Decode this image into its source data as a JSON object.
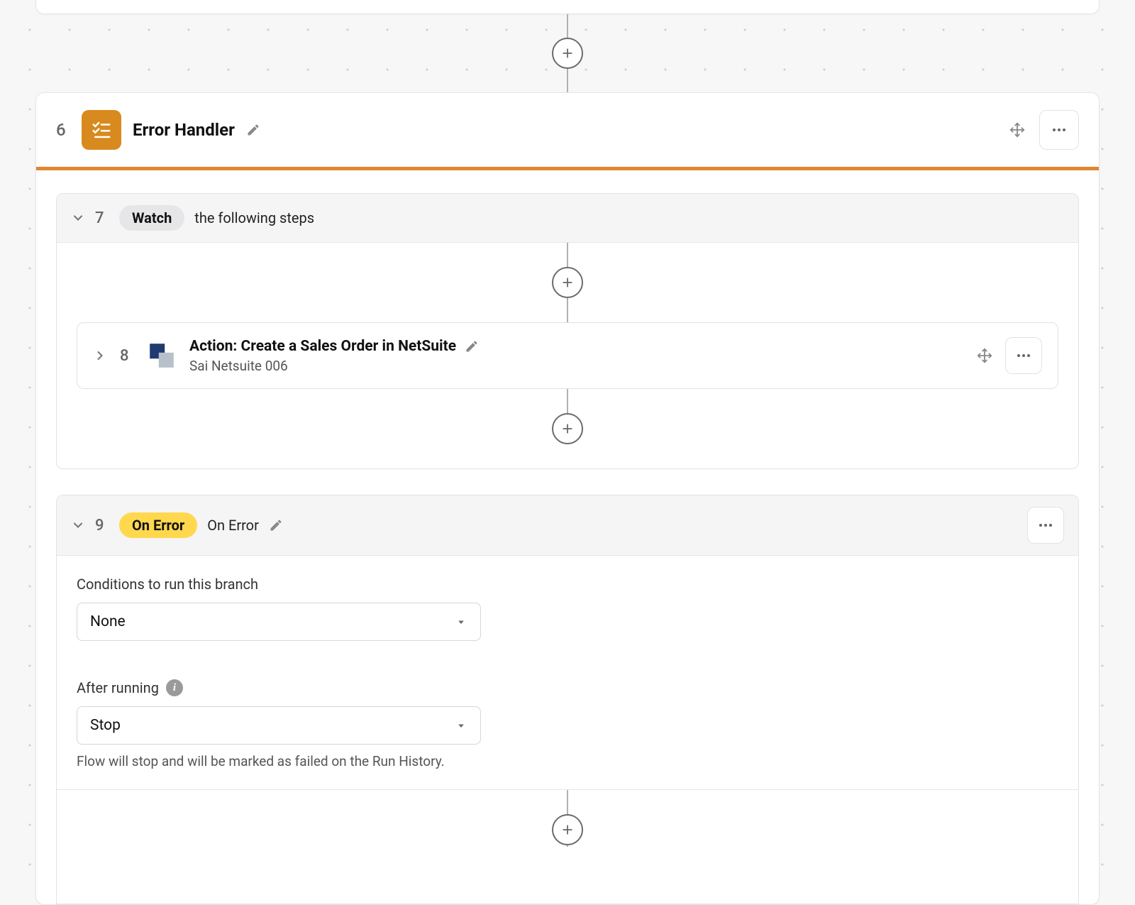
{
  "step6": {
    "number": "6",
    "title": "Error Handler"
  },
  "step7": {
    "number": "7",
    "pill": "Watch",
    "text": "the following steps"
  },
  "step8": {
    "number": "8",
    "title": "Action: Create a Sales Order in NetSuite",
    "subtitle": "Sai Netsuite 006"
  },
  "step9": {
    "number": "9",
    "pill": "On Error",
    "text": "On Error",
    "conditions_label": "Conditions to run this branch",
    "conditions_value": "None",
    "after_label": "After running",
    "after_value": "Stop",
    "hint": "Flow will stop and will be marked as failed on the Run History."
  }
}
